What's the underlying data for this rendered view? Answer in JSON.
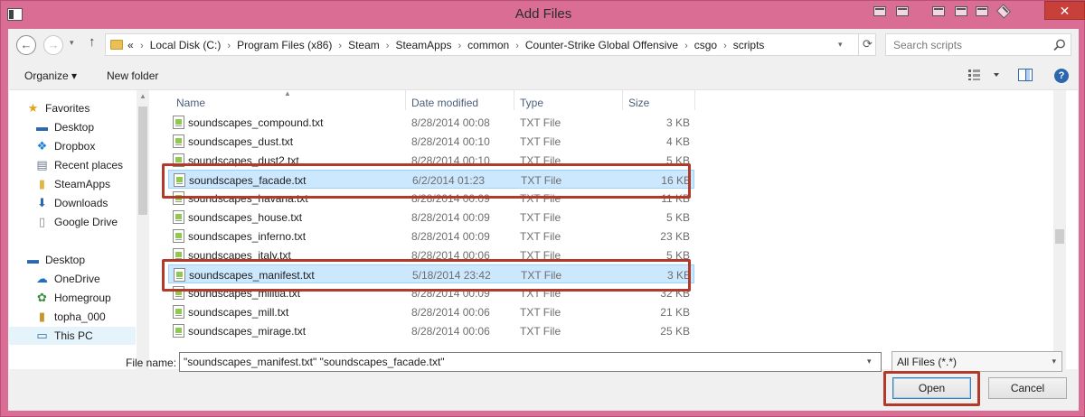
{
  "window": {
    "title": "Add Files",
    "close_label": "✕"
  },
  "address": {
    "overflow": "«",
    "crumbs": [
      "Local Disk (C:)",
      "Program Files (x86)",
      "Steam",
      "SteamApps",
      "common",
      "Counter-Strike Global Offensive",
      "csgo",
      "scripts"
    ],
    "search_placeholder": "Search scripts"
  },
  "toolbar": {
    "organize_label": "Organize ▾",
    "new_folder_label": "New folder",
    "help_label": "?"
  },
  "nav": {
    "favorites": "Favorites",
    "items": [
      "Desktop",
      "Dropbox",
      "Recent places",
      "SteamApps",
      "Downloads",
      "Google Drive"
    ],
    "desktop_root": "Desktop",
    "tree": [
      "OneDrive",
      "Homegroup",
      "topha_000",
      "This PC"
    ]
  },
  "columns": {
    "name": "Name",
    "date": "Date modified",
    "type": "Type",
    "size": "Size"
  },
  "files": [
    {
      "name": "soundscapes_compound.txt",
      "date": "8/28/2014 00:08",
      "type": "TXT File",
      "size": "3 KB"
    },
    {
      "name": "soundscapes_dust.txt",
      "date": "8/28/2014 00:10",
      "type": "TXT File",
      "size": "4 KB"
    },
    {
      "name": "soundscapes_dust2.txt",
      "date": "8/28/2014 00:10",
      "type": "TXT File",
      "size": "5 KB"
    },
    {
      "name": "soundscapes_facade.txt",
      "date": "6/2/2014 01:23",
      "type": "TXT File",
      "size": "16 KB"
    },
    {
      "name": "soundscapes_havana.txt",
      "date": "8/28/2014 00:09",
      "type": "TXT File",
      "size": "11 KB"
    },
    {
      "name": "soundscapes_house.txt",
      "date": "8/28/2014 00:09",
      "type": "TXT File",
      "size": "5 KB"
    },
    {
      "name": "soundscapes_inferno.txt",
      "date": "8/28/2014 00:09",
      "type": "TXT File",
      "size": "23 KB"
    },
    {
      "name": "soundscapes_italy.txt",
      "date": "8/28/2014 00:06",
      "type": "TXT File",
      "size": "5 KB"
    },
    {
      "name": "soundscapes_manifest.txt",
      "date": "5/18/2014 23:42",
      "type": "TXT File",
      "size": "3 KB"
    },
    {
      "name": "soundscapes_militia.txt",
      "date": "8/28/2014 00:09",
      "type": "TXT File",
      "size": "32 KB"
    },
    {
      "name": "soundscapes_mill.txt",
      "date": "8/28/2014 00:06",
      "type": "TXT File",
      "size": "21 KB"
    },
    {
      "name": "soundscapes_mirage.txt",
      "date": "8/28/2014 00:06",
      "type": "TXT File",
      "size": "25 KB"
    }
  ],
  "selected_rows": [
    "soundscapes_facade.txt",
    "soundscapes_manifest.txt"
  ],
  "bottom": {
    "file_name_label": "File name:",
    "file_name_value": "\"soundscapes_manifest.txt\" \"soundscapes_facade.txt\"",
    "file_type_value": "All Files (*.*)",
    "open_label": "Open",
    "cancel_label": "Cancel"
  },
  "colors": {
    "frame": "#d96d94",
    "selection": "#cce8ff",
    "highlight_box": "#b13a2a",
    "close_button": "#c7403a"
  }
}
